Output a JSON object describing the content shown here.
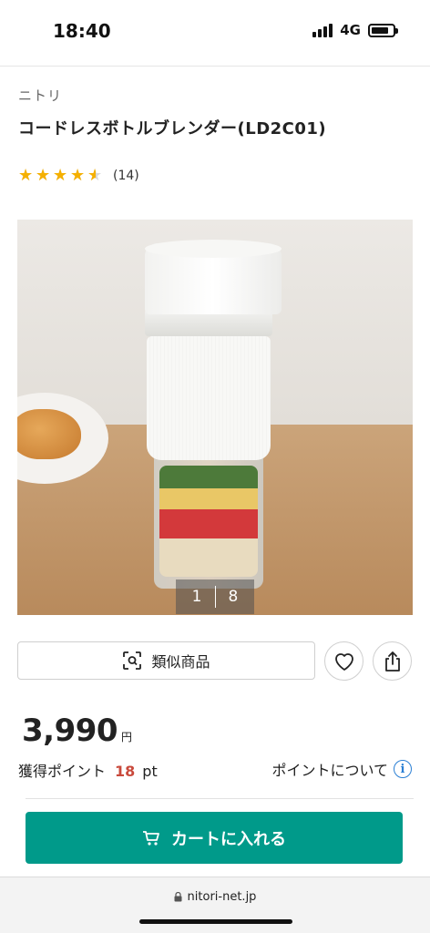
{
  "status_bar": {
    "time": "18:40",
    "network": "4G"
  },
  "product": {
    "brand": "ニトリ",
    "title": "コードレスボトルブレンダー(LD2C01)",
    "rating": 4.5,
    "review_count": "(14)"
  },
  "gallery": {
    "current_page": "1",
    "total_pages": "8"
  },
  "actions": {
    "similar_label": "類似商品",
    "favorite_icon": "heart-icon",
    "share_icon": "share-icon"
  },
  "price": {
    "value": "3,990",
    "unit": "円"
  },
  "points": {
    "label": "獲得ポイント",
    "value": "18",
    "unit": "pt",
    "about_label": "ポイントについて",
    "about_icon": "i"
  },
  "cart": {
    "label": "カートに入れる"
  },
  "browser": {
    "url": "nitori-net.jp"
  },
  "colors": {
    "accent": "#009a8a",
    "star": "#f5b000",
    "points_value": "#c94a3c",
    "info": "#2a7fd4"
  }
}
